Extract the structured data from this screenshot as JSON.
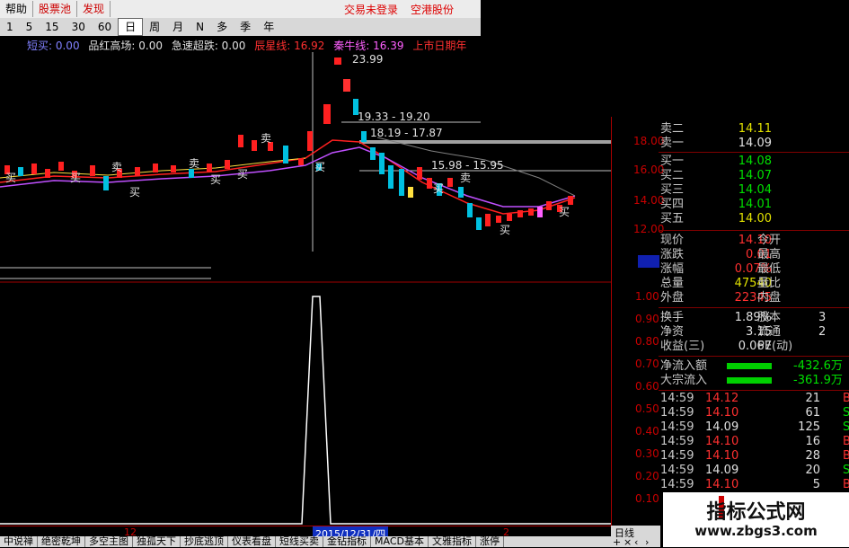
{
  "menu": {
    "items": [
      "帮助",
      "股票池",
      "发现"
    ],
    "status": [
      "交易未登录",
      "空港股份"
    ]
  },
  "periods": [
    "1",
    "5",
    "15",
    "30",
    "60",
    "日",
    "周",
    "月",
    "N",
    "多",
    "季",
    "年"
  ],
  "selected_period": "日",
  "indicators": {
    "a": "短买: 0.00",
    "b": "品红高场: 0.00",
    "c": "急速超跌: 0.00",
    "d": "辰星线: 16.92",
    "e": "秦牛线: 16.39",
    "f": "上市日期年"
  },
  "chart_annotations": {
    "peak": "23.99",
    "r1": "19.33 - 19.20",
    "r2": "18.19 - 17.87",
    "r3": "15.98 - 15.95",
    "buy": "买",
    "sell": "卖"
  },
  "price_axis": [
    "18.00",
    "16.00",
    "14.00",
    "12.00"
  ],
  "ind_axis": [
    "1.00",
    "0.90",
    "0.80",
    "0.70",
    "0.60",
    "0.50",
    "0.40",
    "0.30",
    "0.20",
    "0.10"
  ],
  "orderbook": [
    {
      "label": "卖二",
      "price": "14.11"
    },
    {
      "label": "卖一",
      "price": "14.09"
    },
    {
      "label": "买一",
      "price": "14.08"
    },
    {
      "label": "买二",
      "price": "14.07"
    },
    {
      "label": "买三",
      "price": "14.04"
    },
    {
      "label": "买四",
      "price": "14.01"
    },
    {
      "label": "买五",
      "price": "14.00"
    }
  ],
  "quote": {
    "now_label": "现价",
    "now": "14.10",
    "open_label": "今开",
    "chg_label": "涨跌",
    "chg": "0.01",
    "high_label": "最高",
    "pct_label": "涨幅",
    "pct": "0.07%",
    "low_label": "最低",
    "vol_label": "总量",
    "vol": "47540",
    "ratio_label": "量比",
    "out_label": "外盘",
    "out": "22345",
    "in_label": "内盘",
    "turn_label": "换手",
    "turn": "1.89%",
    "cap_label": "股本",
    "cap": "3",
    "nav_label": "净资",
    "nav": "3.15",
    "float_label": "流通",
    "float": "2",
    "eps_label": "收益(三)",
    "eps": "0.067",
    "pe_label": "PE(动)"
  },
  "flow": [
    {
      "label": "净流入额",
      "value": "-432.6万"
    },
    {
      "label": "大宗流入",
      "value": "-361.9万"
    }
  ],
  "ticks": [
    {
      "time": "14:59",
      "price": "14.12",
      "vol": "21",
      "bs": "B"
    },
    {
      "time": "14:59",
      "price": "14.10",
      "vol": "61",
      "bs": "S"
    },
    {
      "time": "14:59",
      "price": "14.09",
      "vol": "125",
      "bs": "S"
    },
    {
      "time": "14:59",
      "price": "14.10",
      "vol": "16",
      "bs": "B"
    },
    {
      "time": "14:59",
      "price": "14.10",
      "vol": "28",
      "bs": "B"
    },
    {
      "time": "14:59",
      "price": "14.09",
      "vol": "20",
      "bs": "S"
    },
    {
      "time": "14:59",
      "price": "14.10",
      "vol": "5",
      "bs": "B"
    }
  ],
  "date_axis": {
    "m1": "12",
    "cursor": "2015/12/31/四",
    "m2": "2"
  },
  "right_tab": "日线",
  "bottom_tabs": [
    "中说禅",
    "绝密乾坤",
    "多空主图",
    "独孤天下",
    "抄底逃顶",
    "仪表看盘",
    "短线买卖",
    "金钻指标",
    "MACD基本",
    "文雅指标",
    "涨停"
  ],
  "watermark": {
    "title": "指标公式网",
    "url": "www.zbgs3.com"
  }
}
